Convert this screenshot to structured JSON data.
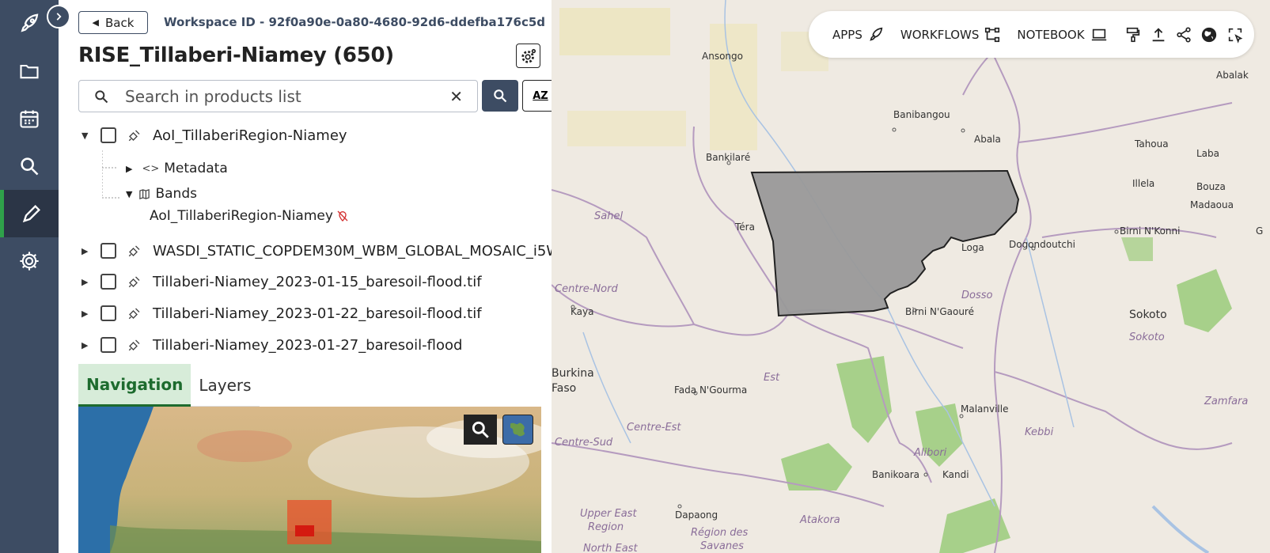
{
  "panel": {
    "back_label": "Back",
    "workspace_id": "Workspace ID - 92f0a90e-0a80-4680-92d6-ddefba176c5d",
    "title": "RISE_Tillaberi-Niamey (650)",
    "search_placeholder": "Search in products list",
    "sort_label": "AZ"
  },
  "tree": {
    "aoi": "AoI_TillaberiRegion-Niamey",
    "metadata": "Metadata",
    "bands": "Bands",
    "band_item": "AoI_TillaberiRegion-Niamey",
    "p2": "WASDI_STATIC_COPDEM30M_WBM_GLOBAL_MOSAIC_i5W",
    "p3": "Tillaberi-Niamey_2023-01-15_baresoil-flood.tif",
    "p4": "Tillaberi-Niamey_2023-01-22_baresoil-flood.tif",
    "p5": "Tillaberi-Niamey_2023-01-27_baresoil-flood"
  },
  "tabs": {
    "navigation": "Navigation",
    "layers": "Layers"
  },
  "topbar": {
    "apps": "APPS",
    "workflows": "WORKFLOWS",
    "notebook": "NOTEBOOK"
  },
  "map_labels": {
    "ansongo": "Ansongo",
    "banibangou": "Banibangou",
    "abala": "Abala",
    "tahoua": "Tahoua",
    "abalak": "Abalak",
    "laba": "Laba",
    "illela": "Illela",
    "bouza": "Bouza",
    "madaoua": "Madaoua",
    "bankilare": "Bankilaré",
    "sahel": "Sahel",
    "tera": "Téra",
    "loga": "Loga",
    "dogondoutchi": "Dogondoutchi",
    "birni_nkonni": "Birni N'Konni",
    "centre_nord": "Centre-Nord",
    "kaya": "Kaya",
    "dosso": "Dosso",
    "birni_ngaoure": "Birni N'Gaouré",
    "sokoto": "Sokoto",
    "sokoto_state": "Sokoto",
    "burkina": "Burkina",
    "faso": "Faso",
    "est": "Est",
    "fada": "Fada N'Gourma",
    "malanville": "Malanville",
    "zamfara": "Zamfara",
    "centre_est": "Centre-Est",
    "kebbi": "Kebbi",
    "centre_sud": "Centre-Sud",
    "alibori": "Alibori",
    "banikoara": "Banikoara",
    "kandi": "Kandi",
    "upper_east": "Upper East",
    "region": "Region",
    "dapaong": "Dapaong",
    "atakora": "Atakora",
    "region_des": "Région des",
    "savanes": "Savanes",
    "north_east": "North East",
    "g": "G"
  },
  "colors": {
    "rail": "#3d4c63",
    "accent_green": "#1d6b2e",
    "tab_bg": "#d7ecd9"
  }
}
